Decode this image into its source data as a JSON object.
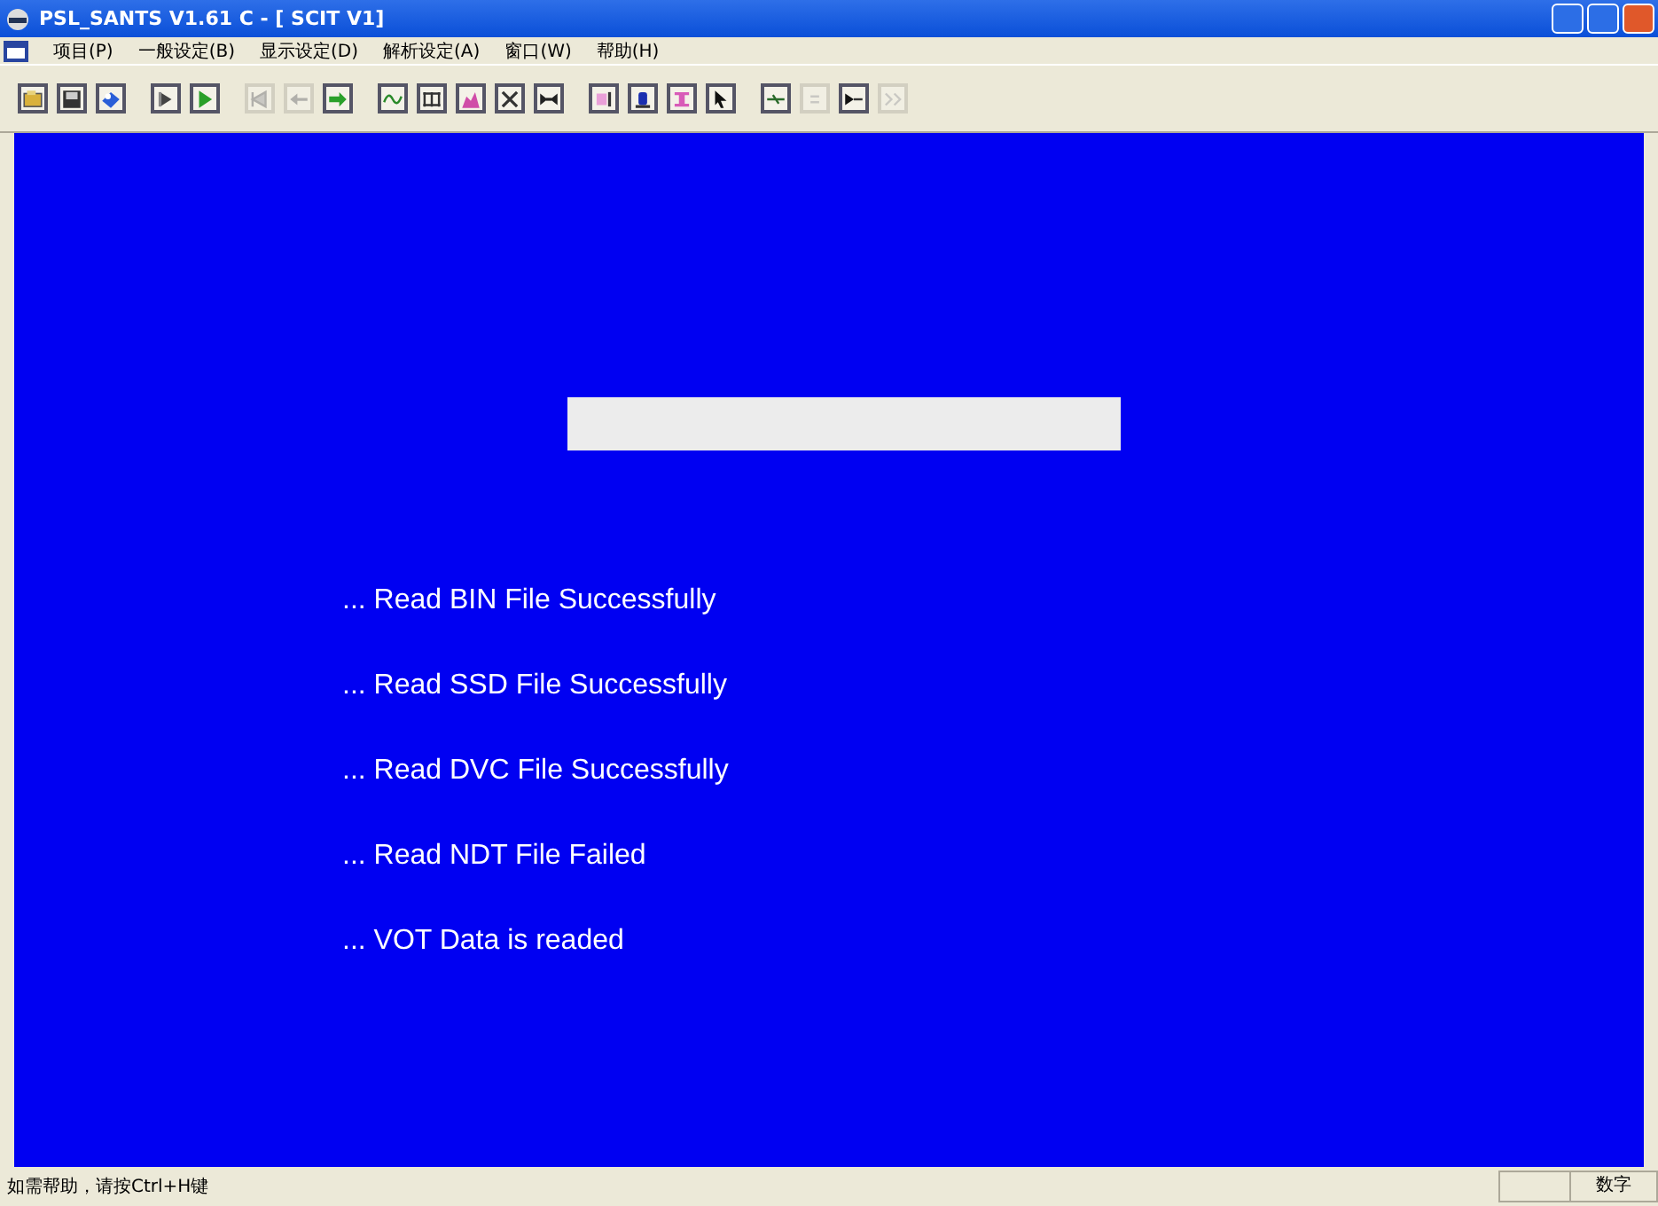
{
  "window": {
    "title": "PSL_SANTS V1.61 C - [ SCIT V1]"
  },
  "menu": [
    "项目(P)",
    "一般设定(B)",
    "显示设定(D)",
    "解析设定(A)",
    "窗口(W)",
    "帮助(H)"
  ],
  "toolbar": [
    [
      {
        "kind": "open",
        "disabled": false
      },
      {
        "kind": "save",
        "disabled": false
      },
      {
        "kind": "load",
        "disabled": false
      }
    ],
    [
      {
        "kind": "step",
        "disabled": false
      },
      {
        "kind": "play",
        "disabled": false
      }
    ],
    [
      {
        "kind": "first",
        "disabled": true
      },
      {
        "kind": "back",
        "disabled": true
      },
      {
        "kind": "forward",
        "disabled": false
      }
    ],
    [
      {
        "kind": "wave",
        "disabled": false
      },
      {
        "kind": "grid",
        "disabled": false
      },
      {
        "kind": "chart",
        "disabled": false
      },
      {
        "kind": "cross",
        "disabled": false
      },
      {
        "kind": "bowtie",
        "disabled": false
      }
    ],
    [
      {
        "kind": "marker",
        "disabled": false
      },
      {
        "kind": "figure",
        "disabled": false
      },
      {
        "kind": "beam",
        "disabled": false
      },
      {
        "kind": "cursor",
        "disabled": false
      }
    ],
    [
      {
        "kind": "line",
        "disabled": false
      },
      {
        "kind": "dots",
        "disabled": true
      },
      {
        "kind": "tee",
        "disabled": false
      },
      {
        "kind": "next",
        "disabled": true
      }
    ]
  ],
  "messages": [
    "... Read BIN File Successfully",
    "... Read SSD File Successfully",
    "... Read DVC File Successfully",
    "... Read NDT File Failed",
    "... VOT Data is readed"
  ],
  "status_bar": {
    "text": "如需帮助，请按Ctrl+H键",
    "indicator": "数字"
  }
}
